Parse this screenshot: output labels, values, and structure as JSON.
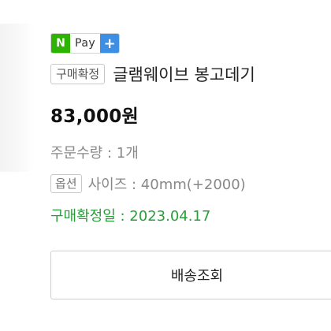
{
  "payment": {
    "badge_letter": "N",
    "badge_label": "Pay",
    "badge_plus": "+",
    "brand_green": "#2db400",
    "plus_blue": "#3d8fe6"
  },
  "order": {
    "status_tag": "구매확정",
    "product_title": "글램웨이브 봉고데기",
    "price": "83,000원",
    "quantity": "주문수량 : 1개",
    "option_tag": "옵션",
    "option_text": "사이즈 : 40mm(+2000)",
    "confirm_date": "구매확정일 : 2023.04.17",
    "confirm_color": "#2a9d3b"
  },
  "actions": {
    "track_shipping_label": "배송조회"
  }
}
